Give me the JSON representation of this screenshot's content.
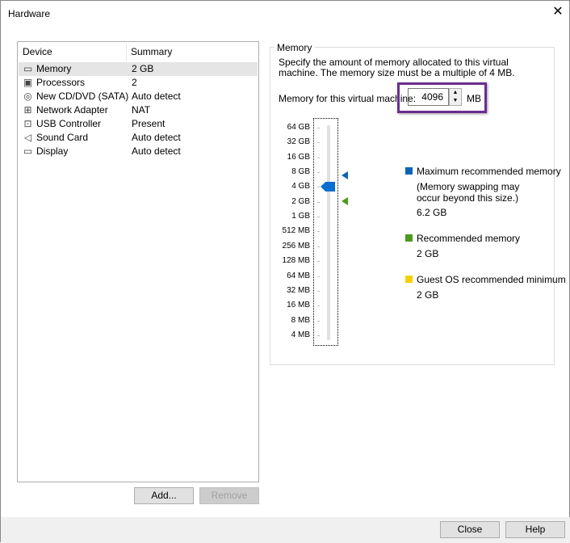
{
  "window": {
    "title": "Hardware",
    "close_icon": "close-icon"
  },
  "device_list": {
    "columns": [
      "Device",
      "Summary"
    ],
    "rows": [
      {
        "device": "Memory",
        "summary": "2 GB",
        "icon": "memory-icon",
        "selected": true
      },
      {
        "device": "Processors",
        "summary": "2",
        "icon": "processor-icon"
      },
      {
        "device": "New CD/DVD (SATA)",
        "summary": "Auto detect",
        "icon": "cd-dvd-icon"
      },
      {
        "device": "Network Adapter",
        "summary": "NAT",
        "icon": "network-icon"
      },
      {
        "device": "USB Controller",
        "summary": "Present",
        "icon": "usb-icon"
      },
      {
        "device": "Sound Card",
        "summary": "Auto detect",
        "icon": "speaker-icon"
      },
      {
        "device": "Display",
        "summary": "Auto detect",
        "icon": "monitor-icon"
      }
    ]
  },
  "buttons": {
    "add": "Add...",
    "remove": "Remove",
    "close": "Close",
    "help": "Help"
  },
  "memory": {
    "group_label": "Memory",
    "description": "Specify the amount of memory allocated to this virtual machine. The memory size must be a multiple of 4 MB.",
    "field_label": "Memory for this virtual machine:",
    "value": "4096",
    "unit": "MB",
    "slider_ticks": [
      "64 GB",
      "32 GB",
      "16 GB",
      "8 GB",
      "4 GB",
      "2 GB",
      "1 GB",
      "512 MB",
      "256 MB",
      "128 MB",
      "64 MB",
      "32 MB",
      "16 MB",
      "8 MB",
      "4 MB"
    ],
    "slider_value": "4 GB",
    "legend": {
      "max_label": "Maximum recommended memory",
      "max_note": "(Memory swapping may occur beyond this size.)",
      "max_value": "6.2 GB",
      "rec_label": "Recommended memory",
      "rec_value": "2 GB",
      "min_label": "Guest OS recommended minimum",
      "min_value": "2 GB"
    },
    "colors": {
      "max": "#0a64b4",
      "rec": "#4b9a1e",
      "min": "#f5d000",
      "thumb": "#0a6fd1",
      "highlight": "#6b2d8f"
    }
  }
}
